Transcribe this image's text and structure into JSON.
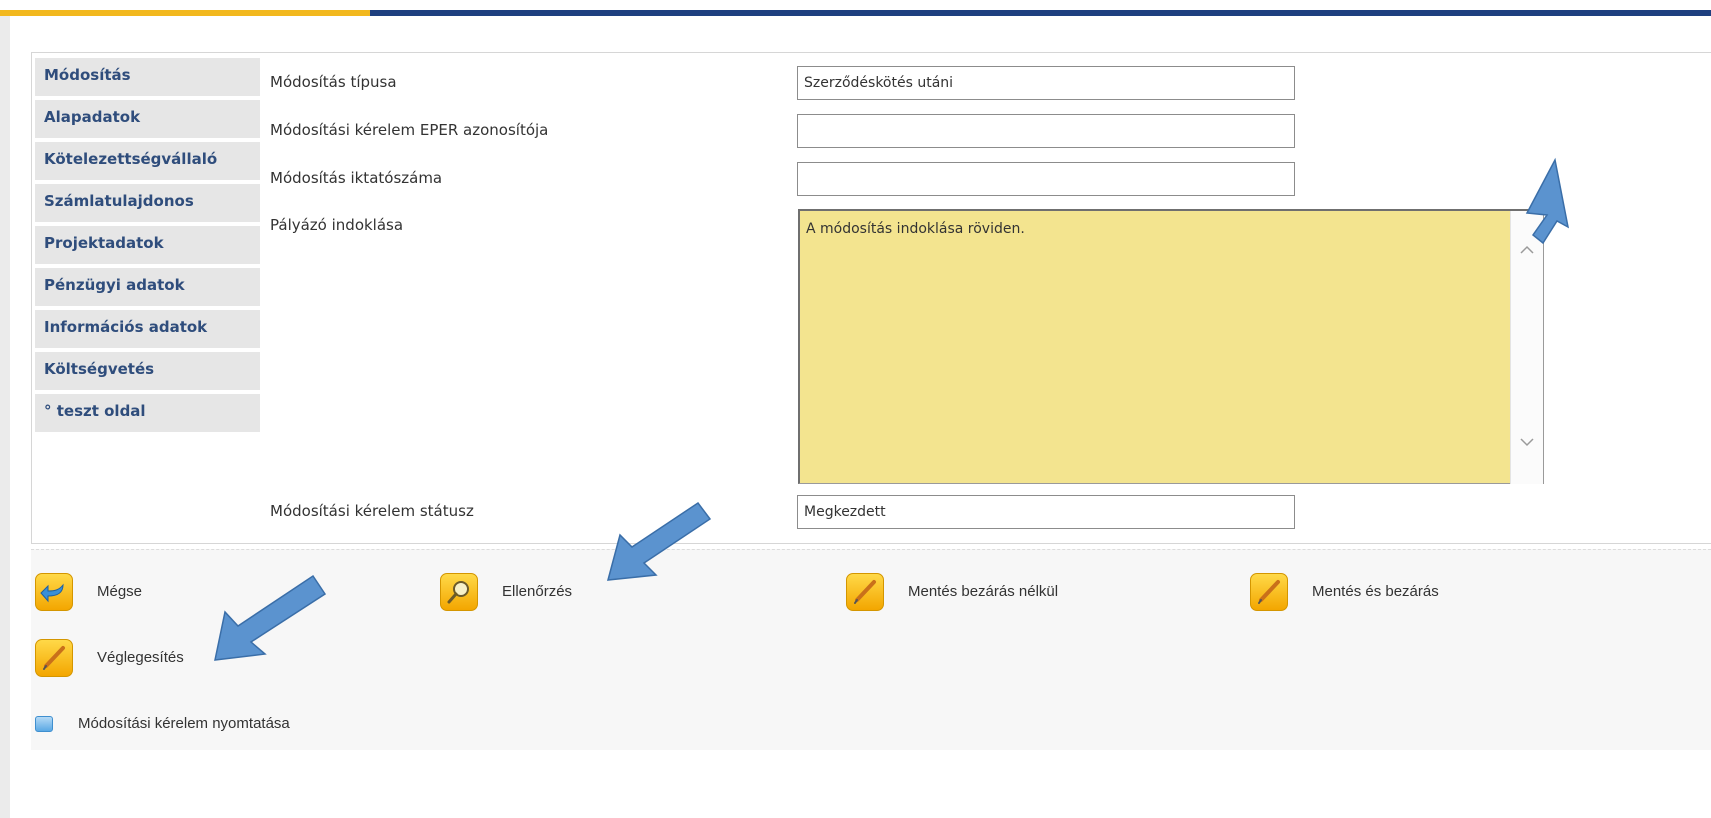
{
  "sidebar": {
    "items": [
      {
        "label": "Módosítás"
      },
      {
        "label": "Alapadatok"
      },
      {
        "label": "Kötelezettségvállaló"
      },
      {
        "label": "Számlatulajdonos"
      },
      {
        "label": "Projektadatok"
      },
      {
        "label": "Pénzügyi adatok"
      },
      {
        "label": "Információs adatok"
      },
      {
        "label": "Költségvetés"
      },
      {
        "label": "° teszt oldal"
      }
    ]
  },
  "form": {
    "modification_type": {
      "label": "Módosítás típusa",
      "value": "Szerződéskötés utáni"
    },
    "eper_id": {
      "label": "Módosítási kérelem EPER azonosítója",
      "value": ""
    },
    "filing_number": {
      "label": "Módosítás iktatószáma",
      "value": ""
    },
    "justification": {
      "label": "Pályázó indoklása",
      "value": "A módosítás indoklása röviden."
    },
    "status": {
      "label": "Módosítási kérelem státusz",
      "value": "Megkezdett"
    }
  },
  "toolbar": {
    "cancel_label": "Mégse",
    "check_label": "Ellenőrzés",
    "save_no_close_label": "Mentés bezárás nélkül",
    "save_close_label": "Mentés és bezárás",
    "finalize_label": "Véglegesítés"
  },
  "print": {
    "label": "Módosítási kérelem nyomtatása"
  },
  "colors": {
    "accent_gold": "#f2b81e",
    "accent_navy": "#1e3f7f",
    "nav_text": "#2f4d7c",
    "textarea_bg": "#f3e48f",
    "annotation_arrow": "#5b93cf"
  },
  "icons": {
    "cancel": "back-arrow-icon",
    "check": "magnifier-icon",
    "save": "pencil-icon",
    "print": "print-icon"
  }
}
